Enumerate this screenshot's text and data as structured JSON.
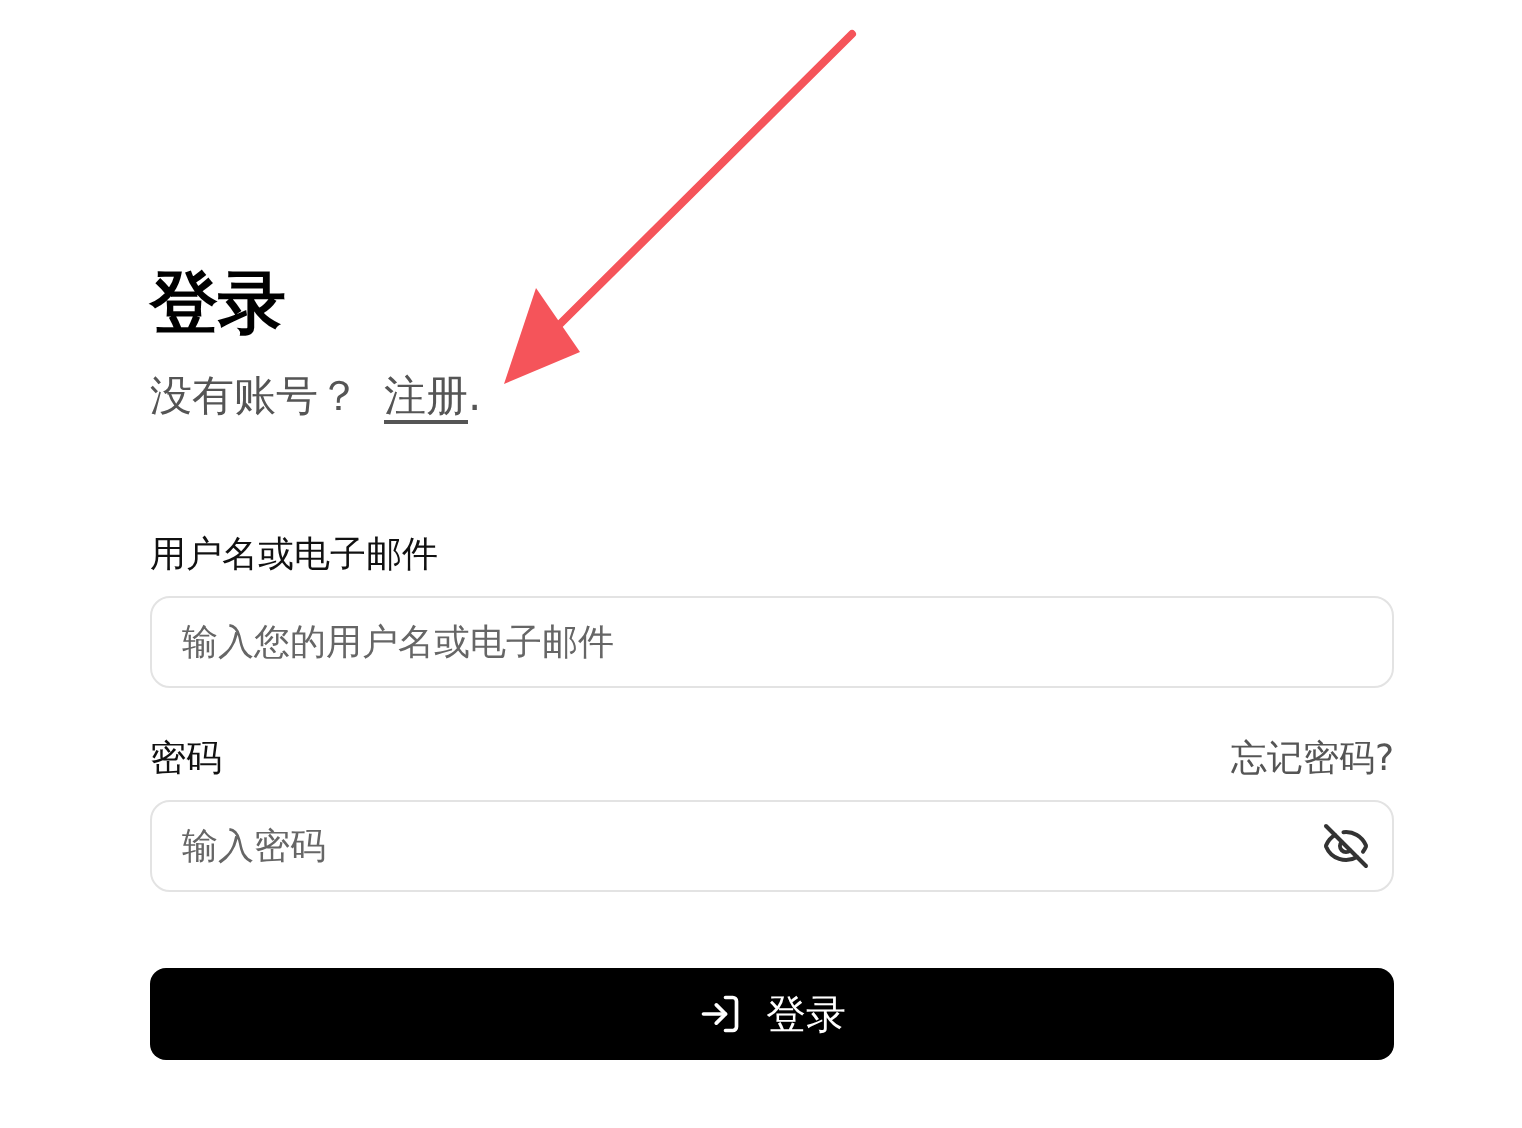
{
  "title": "登录",
  "signup": {
    "prompt": "没有账号？",
    "link": "注册",
    "suffix": "."
  },
  "username": {
    "label": "用户名或电子邮件",
    "placeholder": "输入您的用户名或电子邮件"
  },
  "password": {
    "label": "密码",
    "forgot": "忘记密码?",
    "placeholder": "输入密码",
    "visible": false
  },
  "submit": {
    "label": "登录"
  }
}
